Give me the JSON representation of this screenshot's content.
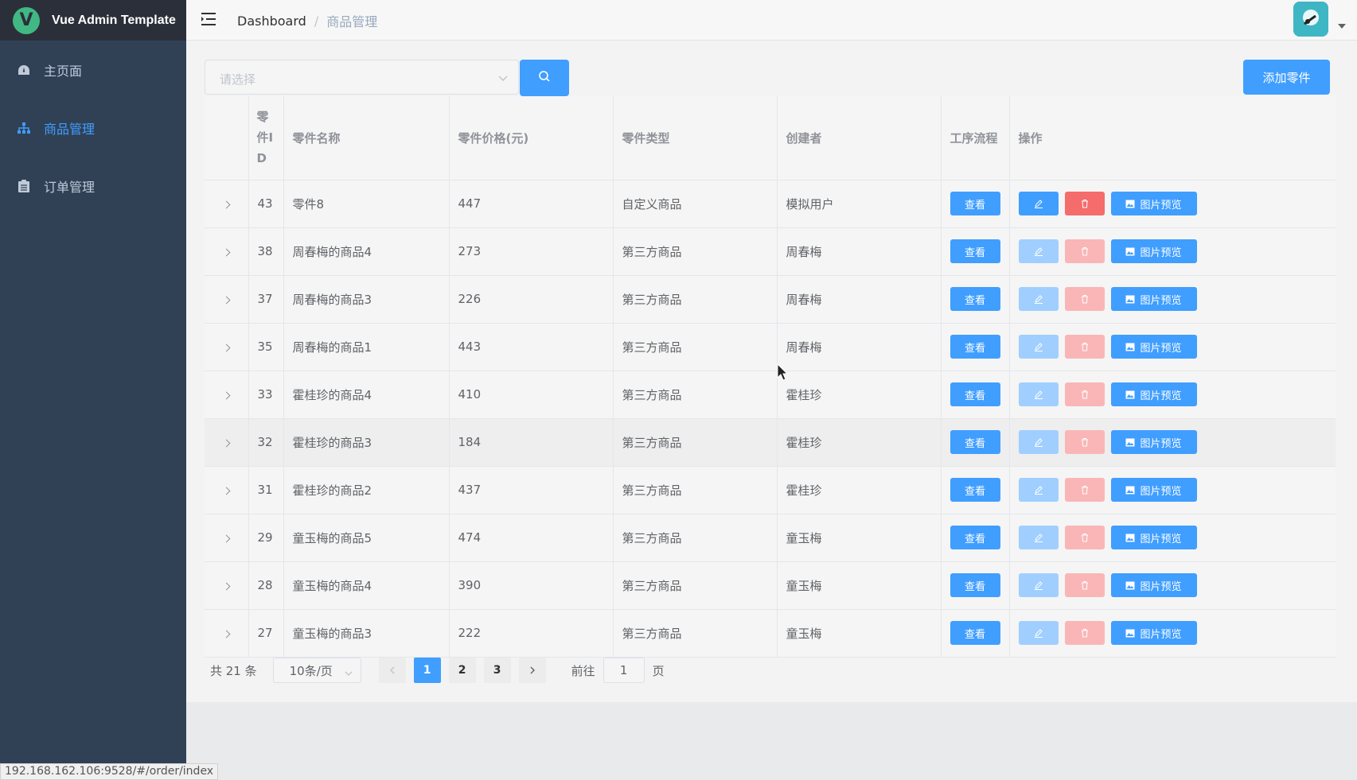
{
  "app": {
    "title": "Vue Admin Template",
    "logo_letter": "V"
  },
  "sidebar": {
    "items": [
      {
        "label": "主页面",
        "icon": "dashboard-icon",
        "active": false
      },
      {
        "label": "商品管理",
        "icon": "tree-icon",
        "active": true
      },
      {
        "label": "订单管理",
        "icon": "clipboard-icon",
        "active": false
      }
    ]
  },
  "navbar": {
    "breadcrumb": {
      "home": "Dashboard",
      "separator": "/",
      "current": "商品管理"
    }
  },
  "toolbar": {
    "select_placeholder": "请选择",
    "add_label": "添加零件"
  },
  "table": {
    "headers": {
      "id": [
        "零",
        "件I",
        "D"
      ],
      "name": "零件名称",
      "price": "零件价格(元)",
      "type": "零件类型",
      "creator": "创建者",
      "process": "工序流程",
      "actions": "操作"
    },
    "view_label": "查看",
    "image_label": "图片预览",
    "rows": [
      {
        "id": "43",
        "name": "零件8",
        "price": "447",
        "type": "自定义商品",
        "creator": "模拟用户",
        "editable": true
      },
      {
        "id": "38",
        "name": "周春梅的商品4",
        "price": "273",
        "type": "第三方商品",
        "creator": "周春梅",
        "editable": false
      },
      {
        "id": "37",
        "name": "周春梅的商品3",
        "price": "226",
        "type": "第三方商品",
        "creator": "周春梅",
        "editable": false
      },
      {
        "id": "35",
        "name": "周春梅的商品1",
        "price": "443",
        "type": "第三方商品",
        "creator": "周春梅",
        "editable": false
      },
      {
        "id": "33",
        "name": "霍桂珍的商品4",
        "price": "410",
        "type": "第三方商品",
        "creator": "霍桂珍",
        "editable": false
      },
      {
        "id": "32",
        "name": "霍桂珍的商品3",
        "price": "184",
        "type": "第三方商品",
        "creator": "霍桂珍",
        "editable": false
      },
      {
        "id": "31",
        "name": "霍桂珍的商品2",
        "price": "437",
        "type": "第三方商品",
        "creator": "霍桂珍",
        "editable": false
      },
      {
        "id": "29",
        "name": "童玉梅的商品5",
        "price": "474",
        "type": "第三方商品",
        "creator": "童玉梅",
        "editable": false
      },
      {
        "id": "28",
        "name": "童玉梅的商品4",
        "price": "390",
        "type": "第三方商品",
        "creator": "童玉梅",
        "editable": false
      },
      {
        "id": "27",
        "name": "童玉梅的商品3",
        "price": "222",
        "type": "第三方商品",
        "creator": "童玉梅",
        "editable": false
      }
    ]
  },
  "pagination": {
    "total": "共 21 条",
    "page_size": "10条/页",
    "pages": [
      "1",
      "2",
      "3"
    ],
    "current_page": "1",
    "goto_prefix": "前往",
    "goto_value": "1",
    "goto_suffix": "页"
  },
  "status_url": "192.168.162.106:9528/#/order/index",
  "colors": {
    "primary": "#409eff",
    "danger": "#f56c6c",
    "sidebar": "#304156"
  }
}
